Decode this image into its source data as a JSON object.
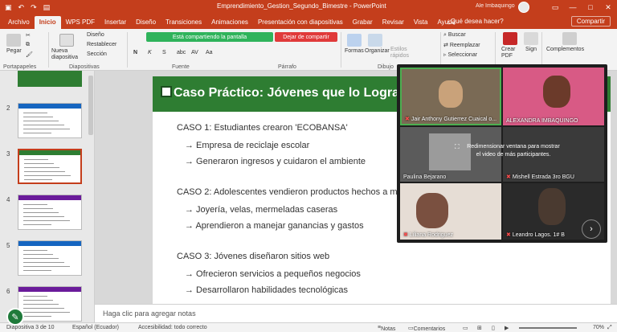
{
  "titlebar": {
    "title": "Emprendimiento_Gestion_Segundo_Bimestre  -  PowerPoint",
    "user": "Ale Imbaquingo",
    "quick_access": [
      "save",
      "undo",
      "redo",
      "start"
    ]
  },
  "ribbon_tabs": [
    "Archivo",
    "Inicio",
    "WPS PDF",
    "Insertar",
    "Diseño",
    "Transiciones",
    "Animaciones",
    "Presentación con diapositivas",
    "Grabar",
    "Revisar",
    "Vista",
    "Ayuda"
  ],
  "tell_me": "¿Qué desea hacer?",
  "share_label": "Compartir",
  "ribbon": {
    "paste": "Pegar",
    "new_slide": "Nueva diapositiva",
    "layout": "Diseño",
    "reset": "Restablecer",
    "section": "Sección",
    "font_buttons": [
      "N",
      "K",
      "S",
      "abc",
      "AV",
      "Aa"
    ],
    "find": "Buscar",
    "replace": "Reemplazar",
    "select": "Seleccionar",
    "shapes": "Formas",
    "arrange": "Organizar",
    "quick_styles": "Estilos rápidos",
    "create_pdf": "Crear PDF",
    "sign": "Sign",
    "addins": "Complementos",
    "groups": [
      "Portapapeles",
      "Diapositivas",
      "Fuente",
      "Párrafo",
      "Dibujo"
    ]
  },
  "sharing": {
    "status": "Está compartiendo la pantalla",
    "stop": "Dejar de compartir"
  },
  "thumbnails": [
    {
      "num": "2"
    },
    {
      "num": "3",
      "selected": true
    },
    {
      "num": "4"
    },
    {
      "num": "5"
    },
    {
      "num": "6"
    }
  ],
  "thumb_colors": [
    "#2e7d32",
    "#1565c0",
    "#2e7d32",
    "#6a1b9a",
    "#1565c0",
    "#6a1b9a"
  ],
  "slide": {
    "title": "Caso Práctico: Jóvenes que lo Logra",
    "lines": [
      {
        "text": "CASO 1: Estudiantes crearon 'ECOBANSA'",
        "sub": false
      },
      {
        "text": "→ Empresa de reciclaje escolar",
        "sub": true
      },
      {
        "text": "→ Generaron ingresos y cuidaron el ambiente",
        "sub": true
      },
      {
        "text": "CASO 2: Adolescentes vendieron productos hechos a mano",
        "sub": false
      },
      {
        "text": "→ Joyería, velas, mermeladas caseras",
        "sub": true
      },
      {
        "text": "→ Aprendieron a manejar ganancias y gastos",
        "sub": true
      },
      {
        "text": "CASO 3: Jóvenes diseñaron sitios web",
        "sub": false
      },
      {
        "text": "→ Ofrecieron servicios a pequeños negocios",
        "sub": true
      },
      {
        "text": "→ Desarrollaron habilidades tecnológicas",
        "sub": true
      }
    ]
  },
  "notes_placeholder": "Haga clic para agregar notas",
  "status": {
    "slide": "Diapositiva 3 de 10",
    "language": "Español (Ecuador)",
    "accessibility": "Accesibilidad: todo correcto",
    "notes": "Notas",
    "comments": "Comentarios",
    "zoom": "70%"
  },
  "meeting": {
    "participants": [
      {
        "name": "Jair Anthony Gutierrez Cuaical o..."
      },
      {
        "name": "ALEXANDRA IMBAQUINGO"
      },
      {
        "name": "Paulina Bejarano"
      },
      {
        "name": "Mishell Estrada 3ro BGU"
      },
      {
        "name": "Liliana Rodriguez"
      },
      {
        "name": "Leandro Lagos. 1# B"
      }
    ],
    "resize_hint": "Redimensionar ventana para mostrar el video de más participantes."
  }
}
